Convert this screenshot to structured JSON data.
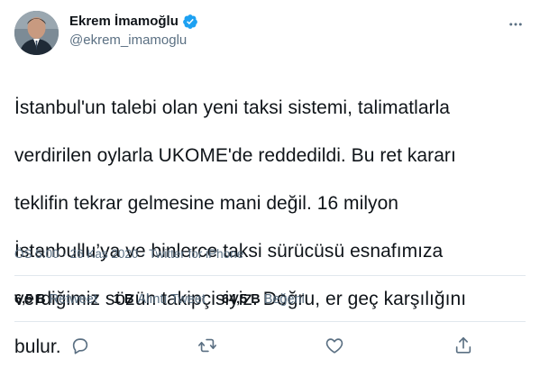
{
  "author": {
    "display_name": "Ekrem İmamoğlu",
    "handle": "@ekrem_imamoglu",
    "verified": true
  },
  "tweet": {
    "text_lines": [
      "İstanbul'un talebi olan yeni taksi sistemi, talimatlarla",
      "verdirilen oylarla UKOME'de reddedildi. Bu ret kararı",
      "teklifin tekrar gelmesine mani değil. 16 milyon",
      "İstanbullu’ya ve binlerce taksi sürücüsü esnafımıza",
      "verdiğimiz sözün takipçisiyiz. Doğru, er geç karşılığını",
      "bulur."
    ]
  },
  "meta": {
    "time": "ÖS 5:00",
    "separator": "·",
    "date": "26 Kas 2020",
    "source": "Twitter for iPhone"
  },
  "stats": {
    "retweets_count": "6,5 B",
    "retweets_label": "Retweet",
    "quotes_count": "1 B",
    "quotes_label": "Alıntı Tweet",
    "likes_count": "64,5 B",
    "likes_label": "Beğeni"
  },
  "actions": [
    "reply-icon",
    "retweet-icon",
    "like-icon",
    "share-icon"
  ],
  "colors": {
    "text": "#0f1419",
    "secondary": "#5b7083",
    "verified": "#1da1f2",
    "divider": "#e1e8ed",
    "icon": "#5b7083"
  }
}
